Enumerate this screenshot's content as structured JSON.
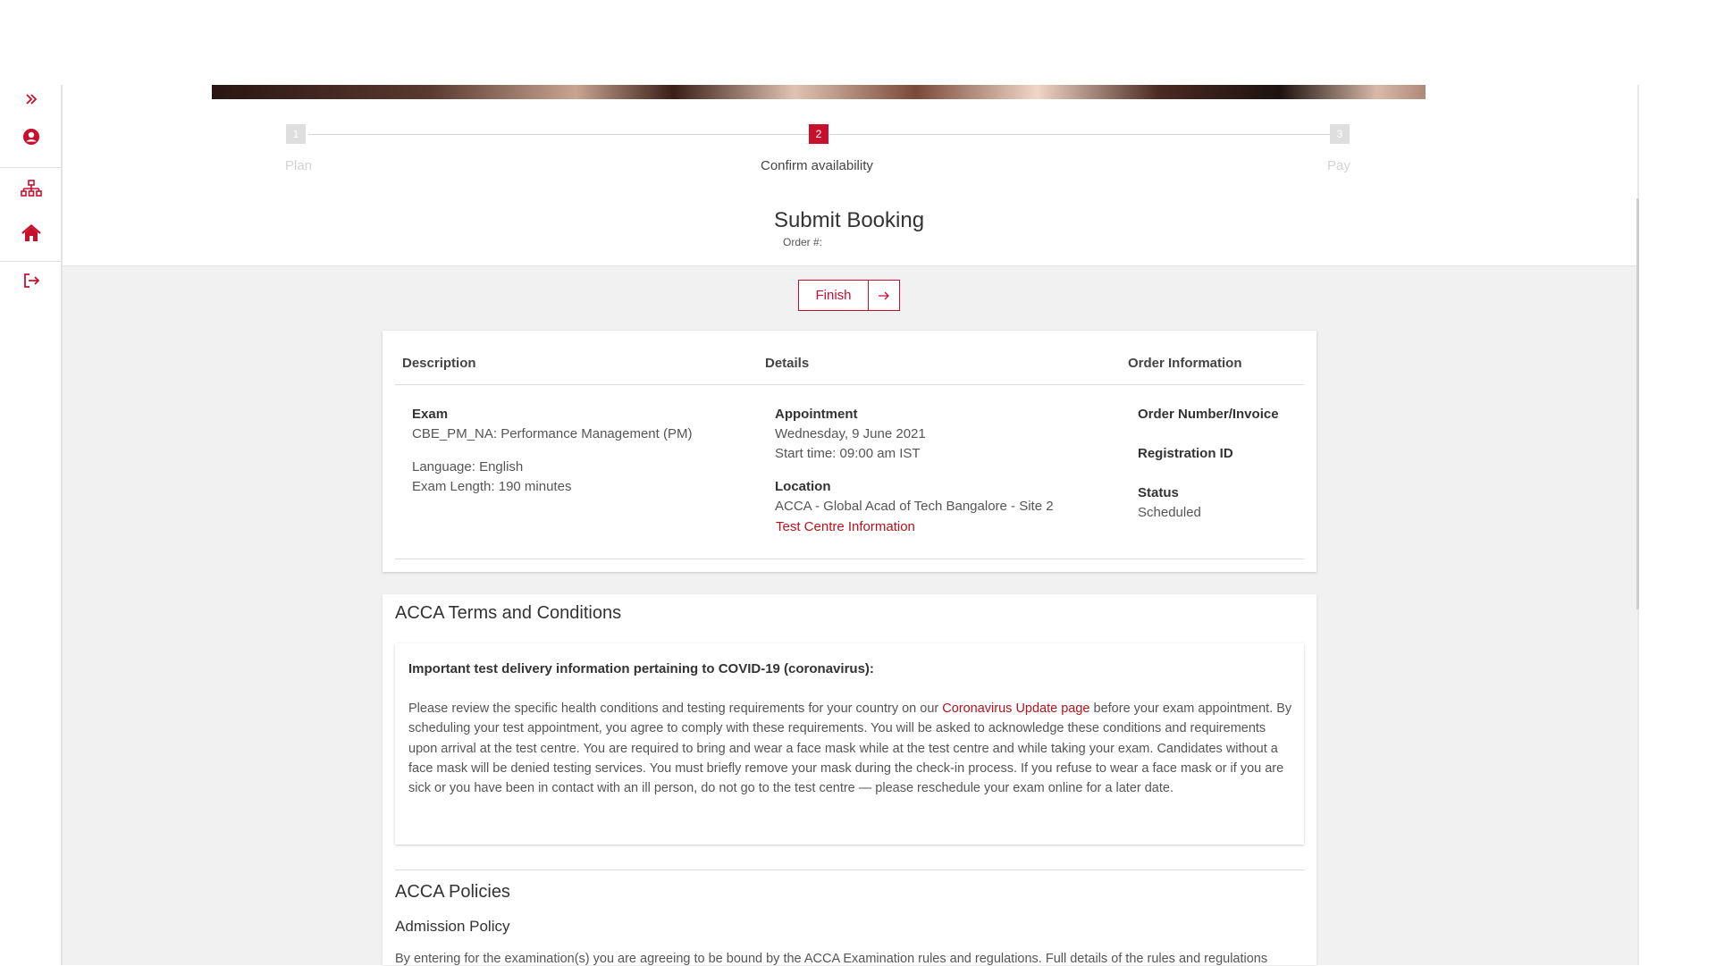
{
  "colors": {
    "accent": "#c8102e",
    "link": "#b5121b",
    "text": "#333333",
    "muted": "#555555",
    "step_inactive": "#dedede",
    "background": "#f1f1f1"
  },
  "sidebar": {
    "items": [
      {
        "name": "expand",
        "icon": "double-chevron-right-icon"
      },
      {
        "name": "profile",
        "icon": "user-circle-icon"
      },
      {
        "name": "sitemap",
        "icon": "sitemap-icon"
      },
      {
        "name": "home",
        "icon": "home-icon"
      },
      {
        "name": "logout",
        "icon": "logout-icon"
      }
    ]
  },
  "stepper": {
    "steps": [
      {
        "number": "1",
        "label": "Plan",
        "state": "inactive"
      },
      {
        "number": "2",
        "label": "Confirm availability",
        "state": "active"
      },
      {
        "number": "3",
        "label": "Pay",
        "state": "inactive"
      }
    ]
  },
  "header": {
    "title": "Submit Booking",
    "order_label": "Order #:"
  },
  "actions": {
    "finish_label": "Finish",
    "finish_icon": "arrow-right-icon"
  },
  "booking": {
    "columns": [
      "Description",
      "Details",
      "Order Information"
    ],
    "exam": {
      "label": "Exam",
      "name": "CBE_PM_NA: Performance Management (PM)",
      "language": "Language: English",
      "length": "Exam Length: 190 minutes"
    },
    "appointment": {
      "label": "Appointment",
      "date": "Wednesday, 9 June 2021",
      "start_time": "Start time: 09:00 am IST"
    },
    "location": {
      "label": "Location",
      "name": "ACCA - Global Acad of Tech Bangalore - Site 2",
      "info_link": "Test Centre Information"
    },
    "order_info": {
      "order_number_label": "Order Number/Invoice",
      "registration_label": "Registration ID",
      "status_label": "Status",
      "status_value": "Scheduled"
    }
  },
  "terms": {
    "title": "ACCA Terms and Conditions",
    "covid_heading": "Important test delivery information pertaining to COVID-19 (coronavirus):",
    "covid_body_1": "Please review the specific health conditions and testing requirements for your country on our ",
    "covid_link": "Coronavirus Update page",
    "covid_body_2": " before your exam appointment. By scheduling your test appointment, you agree to comply with these requirements. You will be asked to acknowledge these conditions and requirements upon arrival at the test centre. You are required to bring and wear a face mask while at the test centre and while taking your exam. Candidates without a face mask will be denied testing services. You must briefly remove your mask during the check-in process. If you refuse to wear a face mask or if you are sick or you have been in contact with an ill person, do not go to the test centre — please reschedule your exam online for a later date."
  },
  "policies": {
    "title": "ACCA Policies",
    "admission_title": "Admission Policy",
    "admission_text": "By entering for the examination(s) you are agreeing to be bound by the ACCA Examination rules and regulations. Full details of the rules and regulations"
  }
}
